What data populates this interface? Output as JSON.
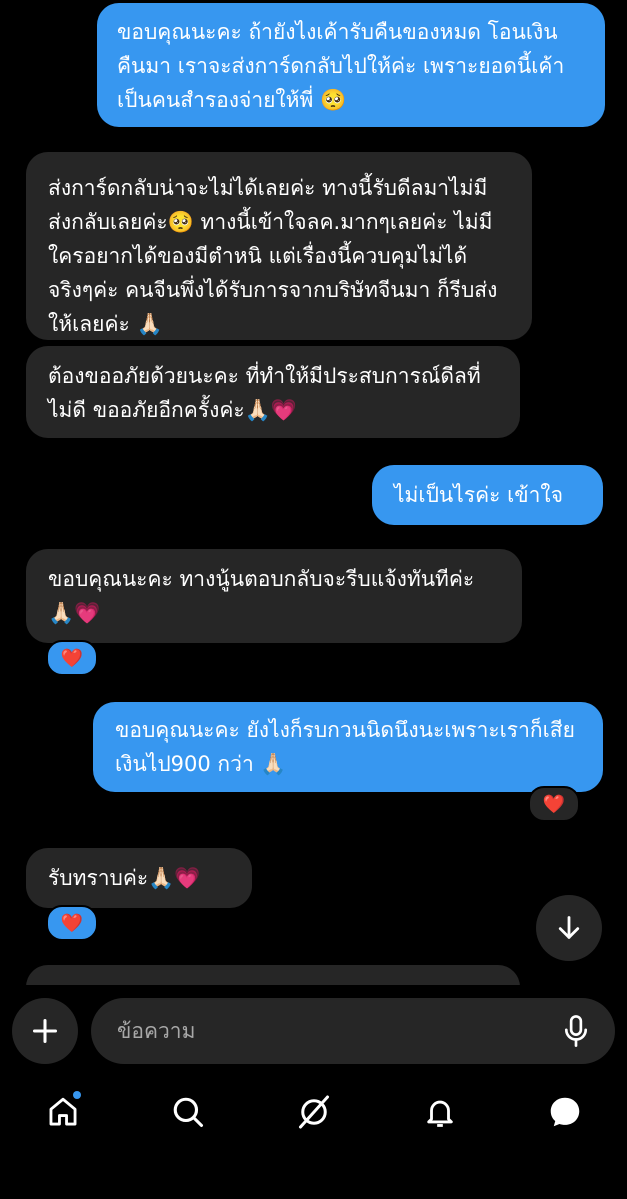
{
  "messages": [
    {
      "dir": "out",
      "text": "ขอบคุณนะคะ ถ้ายังไงเค้ารับคืนของหมด โอนเงินคืนมา เราจะส่งการ์ดกลับไปให้ค่ะ เพราะยอดนี้เค้าเป็นคนสำรองจ่ายให้พี่ 🥺"
    },
    {
      "dir": "in",
      "text": "ส่งการ์ดกลับน่าจะไม่ได้เลยค่ะ ทางนี้รับดีลมาไม่มีส่งกลับเลยค่ะ🥺 ทางนี้เข้าใจลค.มากๆเลยค่ะ ไม่มีใครอยากได้ของมีตำหนิ แต่เรื่องนี้ควบคุมไม่ได้จริงๆค่ะ คนจีนพึ่งได้รับการจากบริษัทจีนมา ก็รีบส่งให้เลยค่ะ 🙏🏻"
    },
    {
      "dir": "in",
      "text": "ต้องขออภัยด้วยนะคะ ที่ทำให้มีประสบการณ์ดีลที่ไม่ดี ขออภัยอีกครั้งค่ะ🙏🏻💗"
    },
    {
      "dir": "out",
      "text": "ไม่เป็นไรค่ะ เข้าใจ"
    },
    {
      "dir": "in",
      "text": "ขอบคุณนะคะ ทางนู้นตอบกลับจะรีบแจ้งทันทีค่ะ🙏🏻💗",
      "reaction": "❤️"
    },
    {
      "dir": "out",
      "text": "ขอบคุณนะคะ ยังไงก็รบกวนนิดนึงนะเพราะเราก็เสียเงินไป900 กว่า 🙏🏻",
      "reaction": "❤️"
    },
    {
      "dir": "in",
      "text": "รับทราบค่ะ🙏🏻💗",
      "reaction": "❤️"
    }
  ],
  "composer": {
    "placeholder": "ข้อความ",
    "plus_label": "+"
  },
  "icons": {
    "scroll": "arrow-down-icon",
    "mic": "microphone-icon",
    "tabs": [
      "home-icon",
      "search-icon",
      "explore-icon",
      "notifications-icon",
      "messages-icon"
    ]
  },
  "colors": {
    "background": "#000000",
    "incoming_bubble": "#262626",
    "outgoing_bubble": "#3797f0",
    "heart": "#ff3040"
  }
}
